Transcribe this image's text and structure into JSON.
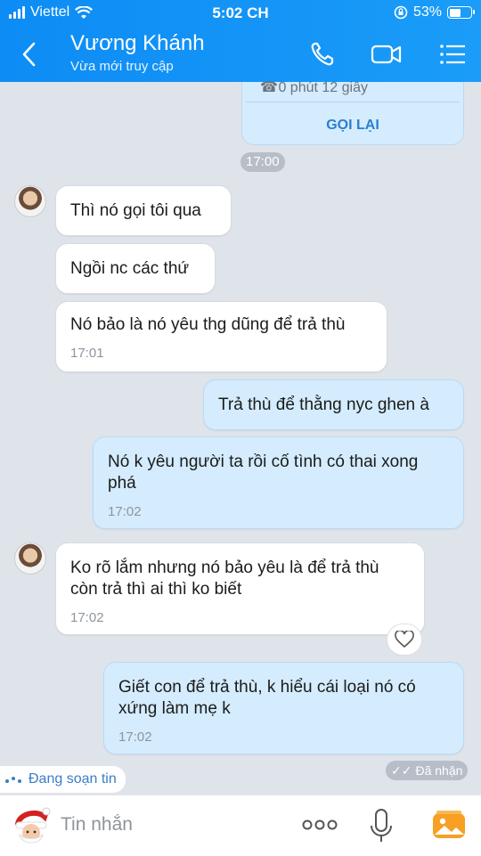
{
  "status_bar": {
    "carrier": "Viettel",
    "time": "5:02 CH",
    "battery_percent": "53%",
    "battery_level": 0.53
  },
  "header": {
    "contact_name": "Vương Khánh",
    "contact_status": "Vừa mới truy cập",
    "icons": [
      "back-icon",
      "phone-icon",
      "video-call-icon",
      "menu-icon"
    ]
  },
  "call_card": {
    "duration": "0 phút 12 giây",
    "action": "GỌI LẠI"
  },
  "timestamp_divider": "17:00",
  "messages": [
    {
      "from": "contact",
      "text": "Thì nó gọi tôi qua",
      "time": ""
    },
    {
      "from": "contact",
      "text": "Ngồi nc các thứ",
      "time": ""
    },
    {
      "from": "contact",
      "text": "Nó bảo là nó yêu thg dũng để trả thù",
      "time": "17:01"
    },
    {
      "from": "me",
      "text": "Trả thù để thằng nyc ghen à",
      "time": ""
    },
    {
      "from": "me",
      "text": "Nó k yêu người ta rồi cố tình có thai xong phá",
      "time": "17:02"
    },
    {
      "from": "contact",
      "text": "Ko rõ lắm nhưng nó bảo yêu là để trả thù còn trả thì ai thì ko biết",
      "time": "17:02"
    },
    {
      "from": "me",
      "text": "Giết con để trả thù, k hiểu cái loại nó có xứng làm mẹ k",
      "time": "17:02"
    }
  ],
  "typing_indicator": "Đang soạn tin",
  "delivery_status": "Đã nhận",
  "composer": {
    "placeholder": "Tin nhắn",
    "icons": [
      "sticker-icon",
      "more-icon",
      "microphone-icon",
      "gallery-icon"
    ]
  },
  "colors": {
    "header_blue": "#0d8cf5",
    "outgoing_bubble": "#d4ecfd",
    "incoming_bubble": "#ffffff",
    "chat_background": "#dfe3ea"
  }
}
